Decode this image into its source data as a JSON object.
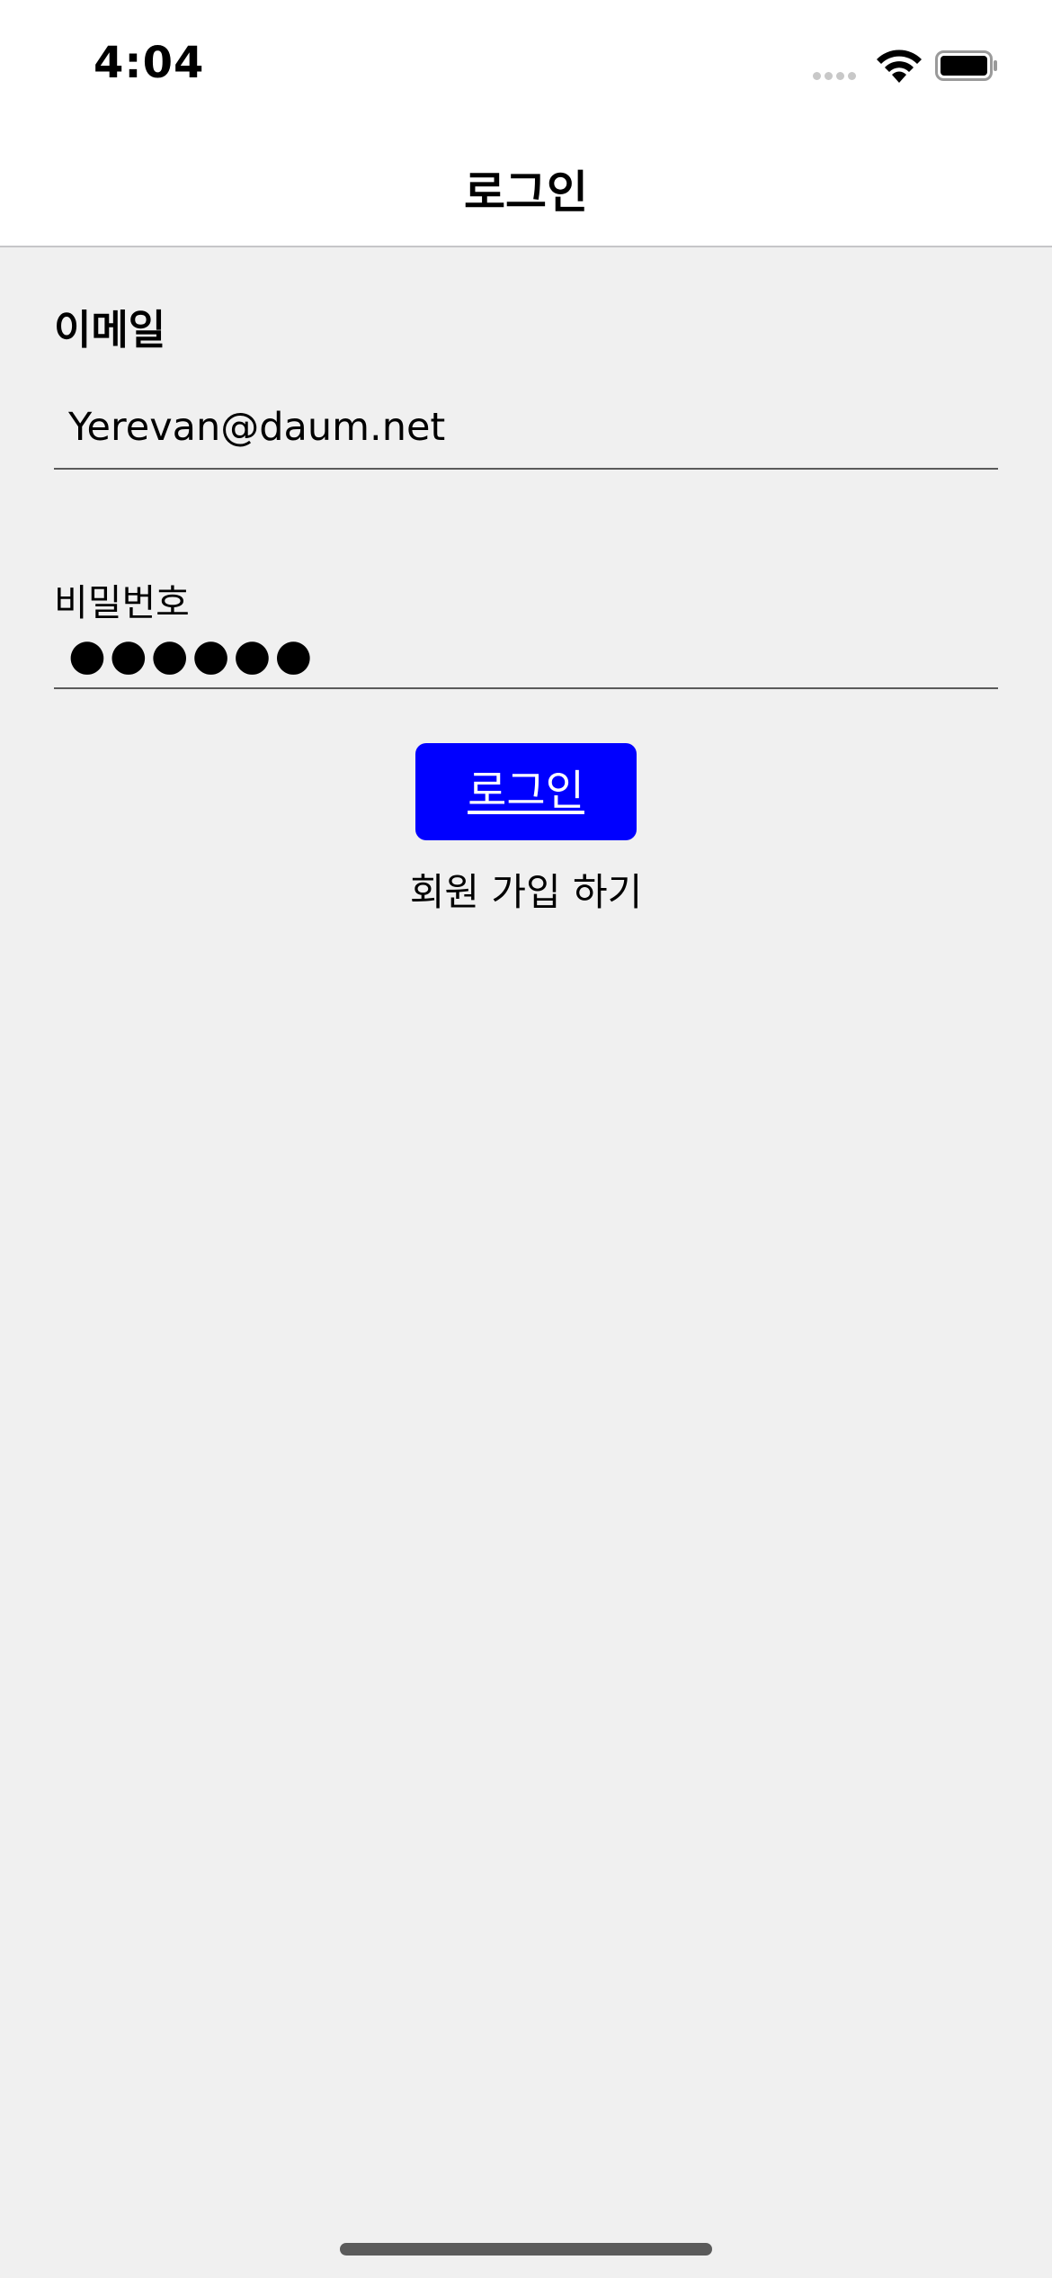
{
  "status_bar": {
    "time": "4:04"
  },
  "nav": {
    "title": "로그인"
  },
  "form": {
    "email_label": "이메일",
    "email_value": "Yerevan@daum.net",
    "password_label": "비밀번호",
    "password_value": "●●●●●●"
  },
  "actions": {
    "login_label": "로그인",
    "signup_label": "회원 가입 하기"
  },
  "colors": {
    "login_button": "#0000ff",
    "background": "#f0f0f0"
  },
  "icons": [
    "signal-icon",
    "wifi-icon",
    "battery-icon"
  ]
}
